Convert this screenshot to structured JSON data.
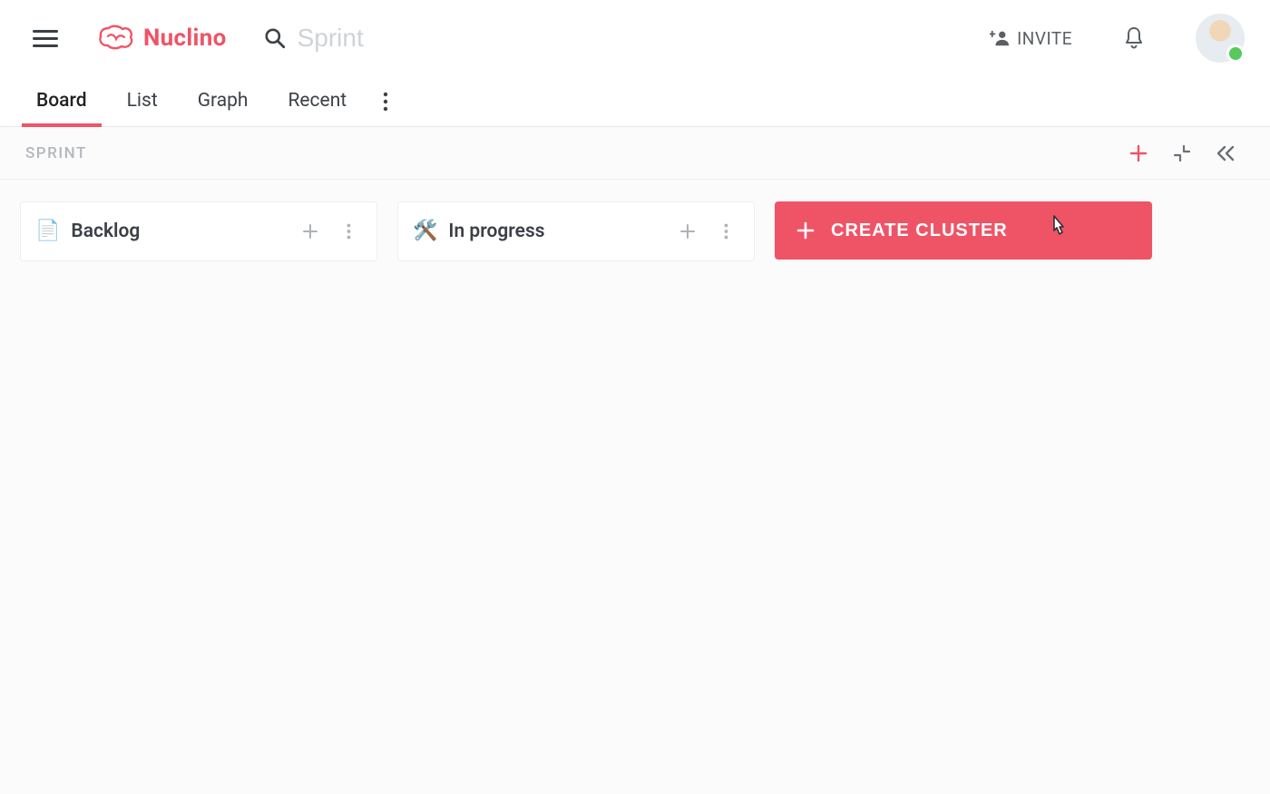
{
  "brand": {
    "name": "Nuclino"
  },
  "header": {
    "search_placeholder": "Sprint",
    "invite_label": "INVITE"
  },
  "tabs": {
    "items": [
      {
        "label": "Board",
        "active": true
      },
      {
        "label": "List",
        "active": false
      },
      {
        "label": "Graph",
        "active": false
      },
      {
        "label": "Recent",
        "active": false
      }
    ]
  },
  "subbar": {
    "title": "SPRINT"
  },
  "board": {
    "columns": [
      {
        "emoji": "📄",
        "title": "Backlog"
      },
      {
        "emoji": "🛠️",
        "title": "In progress"
      }
    ],
    "create_button_label": "CREATE CLUSTER"
  },
  "colors": {
    "brand": "#ef5466"
  }
}
